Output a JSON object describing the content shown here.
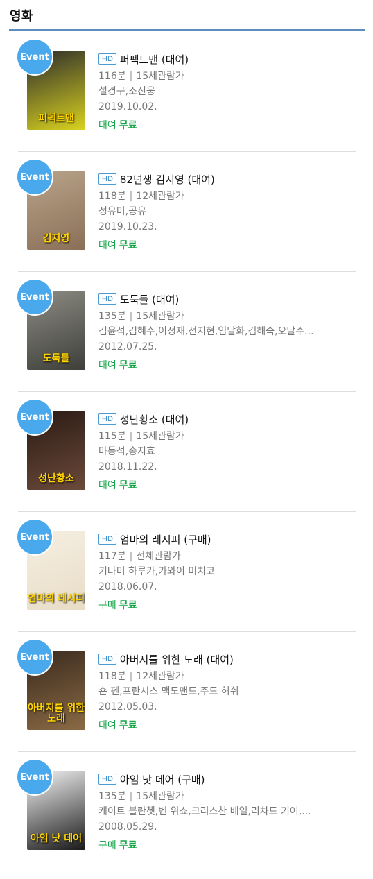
{
  "section": {
    "title": "영화"
  },
  "badges": {
    "event": "Event",
    "hd": "HD"
  },
  "movies": [
    {
      "title": "퍼펙트맨 (대여)",
      "runtime": "116분",
      "rating": "15세관람가",
      "cast": "설경구,조진웅",
      "date": "2019.10.02.",
      "type": "대여",
      "price": "무료",
      "poster_caption": "퍼펙트맨",
      "poster_colors": [
        "#2b2b2b",
        "#d9d21f"
      ]
    },
    {
      "title": "82년생 김지영 (대여)",
      "runtime": "118분",
      "rating": "12세관람가",
      "cast": "정유미,공유",
      "date": "2019.10.23.",
      "type": "대여",
      "price": "무료",
      "poster_caption": "김지영",
      "poster_colors": [
        "#b9a48a",
        "#8a6f58"
      ]
    },
    {
      "title": "도둑들 (대여)",
      "runtime": "135분",
      "rating": "15세관람가",
      "cast": "김윤석,김혜수,이정재,전지현,임달화,김해숙,오달수...",
      "date": "2012.07.25.",
      "type": "대여",
      "price": "무료",
      "poster_caption": "도둑들",
      "poster_colors": [
        "#8c8c84",
        "#3f3f3a"
      ]
    },
    {
      "title": "성난황소 (대여)",
      "runtime": "115분",
      "rating": "15세관람가",
      "cast": "마동석,송지효",
      "date": "2018.11.22.",
      "type": "대여",
      "price": "무료",
      "poster_caption": "성난황소",
      "poster_colors": [
        "#2a1a14",
        "#6b4a3a"
      ]
    },
    {
      "title": "엄마의 레시피 (구매)",
      "runtime": "117분",
      "rating": "전체관람가",
      "cast": "키나미 하루카,카와이 미치코",
      "date": "2018.06.07.",
      "type": "구매",
      "price": "무료",
      "poster_caption": "엄마의 레시피",
      "poster_colors": [
        "#f5efe2",
        "#e8dcc6"
      ]
    },
    {
      "title": "아버지를 위한 노래 (대여)",
      "runtime": "118분",
      "rating": "12세관람가",
      "cast": "숀 펜,프란시스 맥도맨드,주드 허쉬",
      "date": "2012.05.03.",
      "type": "대여",
      "price": "무료",
      "poster_caption": "아버지를 위한 노래",
      "poster_colors": [
        "#3a2a1e",
        "#8a6a44"
      ]
    },
    {
      "title": "아임 낫 데어 (구매)",
      "runtime": "135분",
      "rating": "15세관람가",
      "cast": "케이트 블란쳇,벤 위쇼,크리스찬 베일,리차드 기어,...",
      "date": "2008.05.29.",
      "type": "구매",
      "price": "무료",
      "poster_caption": "아임 낫 데어",
      "poster_colors": [
        "#f4f4f4",
        "#1a1a1a"
      ]
    }
  ]
}
